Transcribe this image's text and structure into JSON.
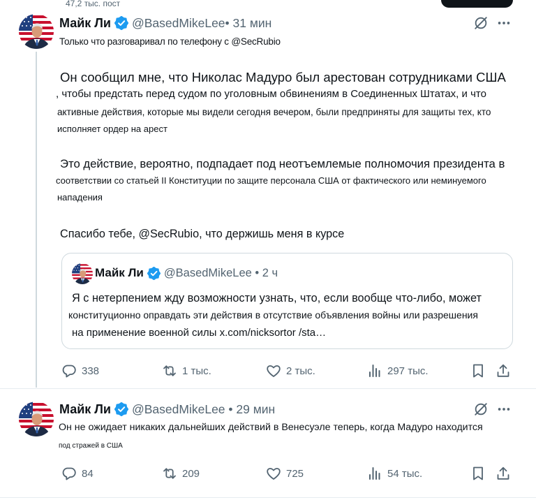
{
  "top": {
    "post_count": "47,2 тыс. пост"
  },
  "tweet1": {
    "name": "Майк Ли",
    "handle_time": "@BasedMikeLee• 31 мин",
    "intro": "Только что разговаривал по телефону с @SecRubio",
    "body": [
      "Он сообщил мне, что Николас Мадуро был арестован сотрудниками США",
      ", чтобы предстать перед судом по уголовным обвинениям в Соединенных Штатах, и что",
      "активные действия, которые мы видели сегодня вечером, были предприняты для защиты тех, кто",
      "исполняет ордер на арест",
      "Это действие, вероятно, подпадает под неотъемлемые полномочия президента в",
      "соответствии со статьей II Конституции по защите персонала США от фактического или неминуемого",
      "нападения"
    ],
    "thanks": "Спасибо тебе, @SecRubio, что держишь меня в курсе",
    "quote": {
      "name": "Майк Ли",
      "handle_time": "@BasedMikeLee • 2 ч",
      "lines": [
        "Я с нетерпением жду возможности узнать, что, если вообще что-либо, может",
        "конституционно оправдать эти действия в отсутствие объявления войны или разрешения",
        "на применение военной силы x.com/nicksortor /sta…"
      ]
    },
    "stats": {
      "replies": "338",
      "reposts": "1 тыс.",
      "likes": "2 тыс.",
      "views": "297 тыс."
    }
  },
  "tweet2": {
    "name": "Майк Ли",
    "handle_time": "@BasedMikeLee • 29 мин",
    "body": [
      "Он не ожидает никаких дальнейших действий в Венесуэле теперь, когда Мадуро находится",
      "под стражей в США"
    ],
    "stats": {
      "replies": "84",
      "reposts": "209",
      "likes": "725",
      "views": "54 тыс."
    }
  },
  "icons": {
    "verified": "verified-badge-icon",
    "grok": "grok-icon",
    "more": "more-icon",
    "reply": "reply-icon",
    "repost": "repost-icon",
    "like": "heart-icon",
    "views": "views-icon",
    "bookmark": "bookmark-icon",
    "share": "share-icon"
  },
  "colors": {
    "text": "#0f1419",
    "secondary": "#536471",
    "verified": "#1d9bf0",
    "border": "#cfd9de"
  }
}
